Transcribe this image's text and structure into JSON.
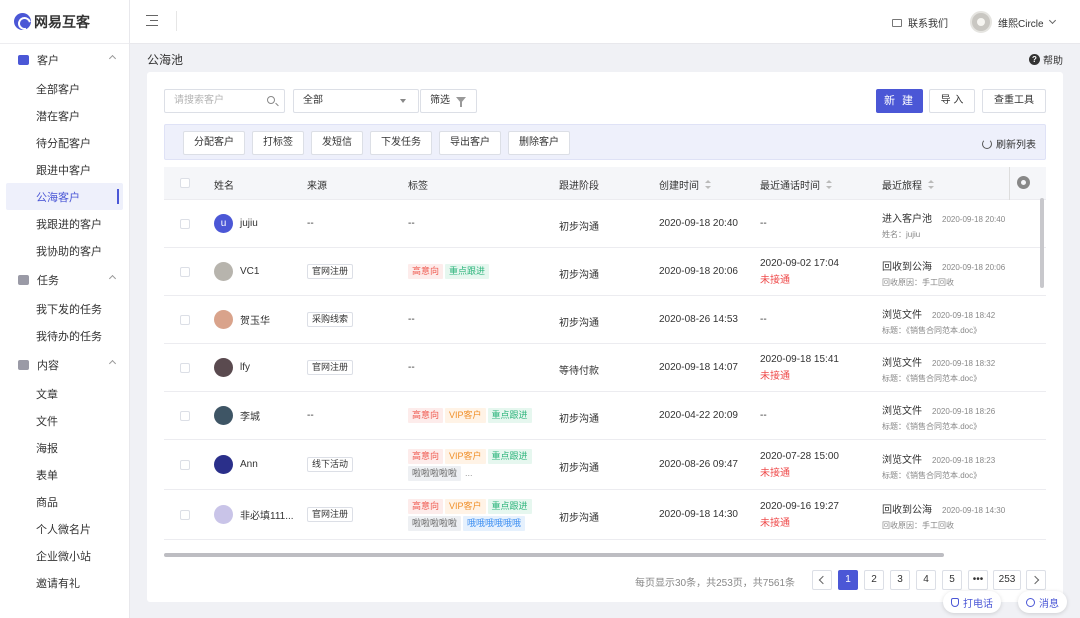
{
  "app": {
    "logo_text": "网易互客",
    "contact_label": "联系我们",
    "user_name": "维熙Circle"
  },
  "sidebar": {
    "groups": [
      {
        "label": "客户",
        "items": [
          "全部客户",
          "潜在客户",
          "待分配客户",
          "跟进中客户",
          "公海客户",
          "我跟进的客户",
          "我协助的客户"
        ]
      },
      {
        "label": "任务",
        "items": [
          "我下发的任务",
          "我待办的任务"
        ]
      },
      {
        "label": "内容",
        "items": [
          "文章",
          "文件",
          "海报",
          "表单",
          "商品",
          "个人微名片",
          "企业微小站",
          "邀请有礼"
        ]
      }
    ],
    "active_item": "公海客户"
  },
  "page": {
    "title": "公海池",
    "help_label": "帮助"
  },
  "toolbar": {
    "search_placeholder": "请搜索客户",
    "select_value": "全部",
    "filter_label": "筛选",
    "new_label": "新 建",
    "import_label": "导 入",
    "dedupe_label": "查重工具"
  },
  "bulk_actions": {
    "buttons": [
      "分配客户",
      "打标签",
      "发短信",
      "下发任务",
      "导出客户",
      "删除客户"
    ],
    "refresh_label": "刷新列表"
  },
  "table": {
    "columns": [
      "姓名",
      "来源",
      "标签",
      "跟进阶段",
      "创建时间",
      "最近通话时间",
      "最近旅程"
    ],
    "rows": [
      {
        "name": "jujiu",
        "avatar_letter": "u",
        "avatar_color": "#4b57d6",
        "source": "--",
        "tags": [],
        "tags_placeholder": "--",
        "stage": "初步沟通",
        "created": "2020-09-18 20:40",
        "call_date": "--",
        "call_status": "",
        "journey_title": "进入客户池",
        "journey_time": "2020-09-18 20:40",
        "journey_sub": "姓名：jujiu"
      },
      {
        "name": "VC1",
        "avatar_letter": "",
        "avatar_color": "#b7b4ad",
        "source": "官网注册",
        "tags": [
          {
            "t": "高意向",
            "c": "red"
          },
          {
            "t": "重点跟进",
            "c": "green"
          }
        ],
        "tags_placeholder": "",
        "stage": "初步沟通",
        "created": "2020-09-18 20:06",
        "call_date": "2020-09-02 17:04",
        "call_status": "未接通",
        "journey_title": "回收到公海",
        "journey_time": "2020-09-18 20:06",
        "journey_sub": "回收原因：手工回收"
      },
      {
        "name": "贺玉华",
        "avatar_letter": "",
        "avatar_color": "#d9a38b",
        "source": "采购线索",
        "tags": [],
        "tags_placeholder": "--",
        "stage": "初步沟通",
        "created": "2020-08-26 14:53",
        "call_date": "--",
        "call_status": "",
        "journey_title": "浏览文件",
        "journey_time": "2020-09-18 18:42",
        "journey_sub": "标题：《销售合同范本.doc》"
      },
      {
        "name": "lfy",
        "avatar_letter": "",
        "avatar_color": "#5a4a4f",
        "source": "官网注册",
        "tags": [],
        "tags_placeholder": "--",
        "stage": "等待付款",
        "created": "2020-09-18 14:07",
        "call_date": "2020-09-18 15:41",
        "call_status": "未接通",
        "journey_title": "浏览文件",
        "journey_time": "2020-09-18 18:32",
        "journey_sub": "标题：《销售合同范本.doc》"
      },
      {
        "name": "李城",
        "avatar_letter": "",
        "avatar_color": "#3e5565",
        "source": "--",
        "tags": [
          {
            "t": "高意向",
            "c": "red"
          },
          {
            "t": "VIP客户",
            "c": "orange"
          },
          {
            "t": "重点跟进",
            "c": "green"
          }
        ],
        "tags_placeholder": "",
        "stage": "初步沟通",
        "created": "2020-04-22 20:09",
        "call_date": "--",
        "call_status": "",
        "journey_title": "浏览文件",
        "journey_time": "2020-09-18 18:26",
        "journey_sub": "标题：《销售合同范本.doc》"
      },
      {
        "name": "Ann",
        "avatar_letter": "",
        "avatar_color": "#2a2f8a",
        "source": "线下活动",
        "tags": [
          {
            "t": "高意向",
            "c": "red"
          },
          {
            "t": "VIP客户",
            "c": "orange"
          },
          {
            "t": "重点跟进",
            "c": "green"
          },
          {
            "t": "啦啦啦啦啦",
            "c": "gray"
          }
        ],
        "tags_more": "...",
        "tags_placeholder": "",
        "stage": "初步沟通",
        "created": "2020-08-26 09:47",
        "call_date": "2020-07-28 15:00",
        "call_status": "未接通",
        "journey_title": "浏览文件",
        "journey_time": "2020-09-18 18:23",
        "journey_sub": "标题：《销售合同范本.doc》"
      },
      {
        "name": "非必填111...",
        "avatar_letter": "",
        "avatar_color": "#c9c4e8",
        "source": "官网注册",
        "tags": [
          {
            "t": "高意向",
            "c": "red"
          },
          {
            "t": "VIP客户",
            "c": "orange"
          },
          {
            "t": "重点跟进",
            "c": "green"
          },
          {
            "t": "啦啦啦啦啦",
            "c": "gray"
          },
          {
            "t": "哦哦哦哦哦哦",
            "c": "blue"
          }
        ],
        "tags_placeholder": "",
        "stage": "初步沟通",
        "created": "2020-09-18 14:30",
        "call_date": "2020-09-16 19:27",
        "call_status": "未接通",
        "journey_title": "回收到公海",
        "journey_time": "2020-09-18 14:30",
        "journey_sub": "回收原因：手工回收"
      }
    ]
  },
  "pagination": {
    "info": "每页显示30条，共253页，共7561条",
    "pages": [
      "1",
      "2",
      "3",
      "4",
      "5"
    ],
    "ellipsis": "•••",
    "last_page": "253",
    "current_page": "1"
  },
  "float_actions": {
    "call_label": "打电话",
    "message_label": "消息"
  },
  "colors": {
    "primary": "#4b57d6",
    "danger": "#ef4b4b"
  }
}
